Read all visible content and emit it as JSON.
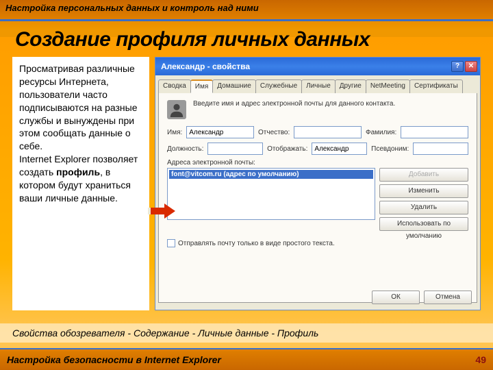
{
  "header": {
    "topbar": "Настройка персональных данных и контроль над ними",
    "title": "Создание профиля личных данных"
  },
  "left_text": {
    "p1": "Просматривая различные ресурсы Интернета, пользователи часто подписываются на разные службы и вынуждены при этом сообщать данные о себе.",
    "p2a": "Internet Explorer позволяет создать ",
    "p2b": "профиль",
    "p2c": ", в котором будут храниться ваши личные данные."
  },
  "window": {
    "title": "Александр - свойства",
    "tabs": [
      "Сводка",
      "Имя",
      "Домашние",
      "Служебные",
      "Личные",
      "Другие",
      "NetMeeting",
      "Сертификаты"
    ],
    "active_tab": 1,
    "intro": "Введите имя и адрес электронной почты для данного контакта.",
    "labels": {
      "first": "Имя:",
      "middle": "Отчество:",
      "last": "Фамилия:",
      "job": "Должность:",
      "display": "Отображать:",
      "nick": "Псевдоним:",
      "emails": "Адреса электронной почты:"
    },
    "values": {
      "first": "Александр",
      "middle": "",
      "last": "",
      "job": "",
      "display": "Александр",
      "nick": ""
    },
    "email_selected": "font@vitcom.ru (адрес по умолчанию)",
    "buttons": {
      "add": "Добавить",
      "edit": "Изменить",
      "delete": "Удалить",
      "default": "Использовать по умолчанию",
      "ok": "ОК",
      "cancel": "Отмена"
    },
    "checkbox": "Отправлять почту только в виде простого текста."
  },
  "breadcrumb": "Свойства обозревателя - Содержание - Личные данные - Профиль",
  "footer": {
    "text": "Настройка безопасности в Internet Explorer",
    "page": "49"
  }
}
